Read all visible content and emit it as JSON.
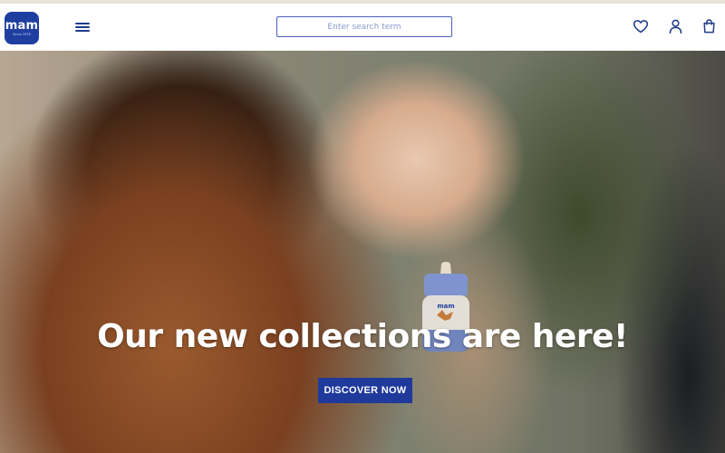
{
  "colors": {
    "brand": "#1e3fa0",
    "cta": "#1f3a9b",
    "icon": "#1e3a8a",
    "accent_strip": "#e9e1d8"
  },
  "header": {
    "logo": {
      "text": "mam",
      "tagline": "Since 1976"
    },
    "menu_icon": "hamburger-icon",
    "search": {
      "placeholder": "Enter search term",
      "value": ""
    },
    "icons": [
      "heart-icon",
      "user-icon",
      "shopping-bag-icon"
    ]
  },
  "hero": {
    "headline": "Our new collections are here!",
    "cta_label": "DISCOVER NOW",
    "bottle_brand": "mam"
  }
}
